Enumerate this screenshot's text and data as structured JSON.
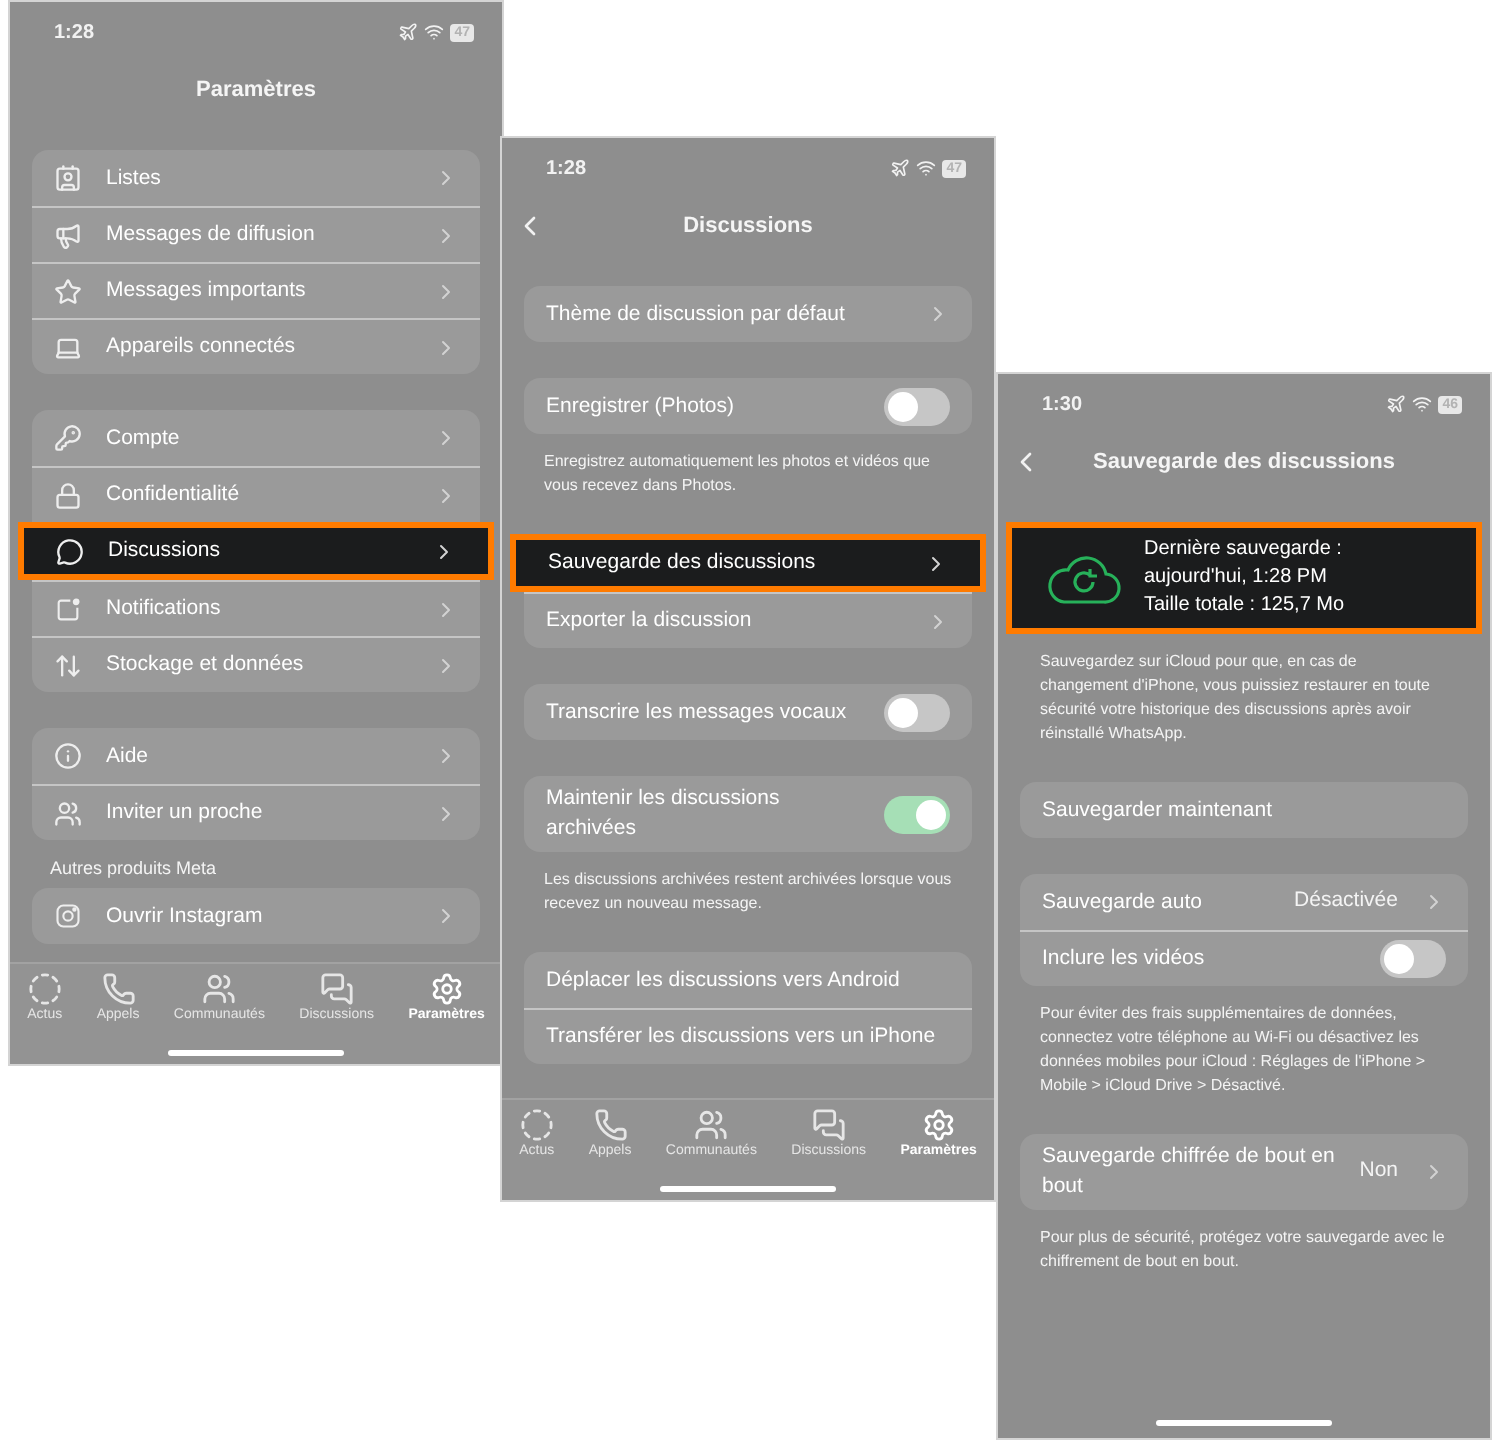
{
  "screens": [
    {
      "time": "1:28",
      "battery": "47",
      "title": "Paramètres",
      "back": false,
      "sections": [
        {
          "items": [
            {
              "kind": "menu",
              "label": "Listes",
              "highlighted": false
            },
            {
              "kind": "menu",
              "label": "Messages de diffusion",
              "highlighted": false
            },
            {
              "kind": "menu",
              "label": "Messages importants",
              "highlighted": false
            },
            {
              "kind": "menu",
              "label": "Appareils connectés",
              "highlighted": false
            }
          ]
        },
        {
          "items": [
            {
              "kind": "menu",
              "label": "Compte",
              "highlighted": false
            },
            {
              "kind": "menu",
              "label": "Confidentialité",
              "highlighted": false
            },
            {
              "kind": "menu",
              "label": "Discussions",
              "highlighted": true
            },
            {
              "kind": "menu",
              "label": "Notifications",
              "highlighted": false
            },
            {
              "kind": "menu",
              "label": "Stockage et données",
              "highlighted": false
            }
          ]
        },
        {
          "items": [
            {
              "kind": "menu",
              "label": "Aide",
              "highlighted": false
            },
            {
              "kind": "menu",
              "label": "Inviter un proche",
              "highlighted": false
            }
          ]
        },
        {
          "header": "Autres produits Meta",
          "items": [
            {
              "kind": "menu",
              "label": "Ouvrir Instagram",
              "highlighted": false
            }
          ]
        }
      ],
      "tabs": [
        {
          "label": "Actus",
          "selected": false
        },
        {
          "label": "Appels",
          "selected": false
        },
        {
          "label": "Communautés",
          "selected": false
        },
        {
          "label": "Discussions",
          "selected": false
        },
        {
          "label": "Paramètres",
          "selected": true
        }
      ]
    },
    {
      "time": "1:28",
      "battery": "47",
      "title": "Discussions",
      "back": true,
      "sections": [
        {
          "items": [
            {
              "kind": "link",
              "label": "Thème de discussion par défaut",
              "highlighted": false
            }
          ]
        },
        {
          "items": [
            {
              "kind": "toggle",
              "label": "Enregistrer (Photos)",
              "on": false,
              "highlighted": false
            }
          ],
          "footer": "Enregistrez automatiquement les photos et vidéos que vous recevez dans Photos."
        },
        {
          "items": [
            {
              "kind": "link",
              "label": "Sauvegarde des discussions",
              "highlighted": true
            },
            {
              "kind": "link",
              "label": "Exporter la discussion",
              "highlighted": false
            }
          ]
        },
        {
          "items": [
            {
              "kind": "toggle",
              "label": "Transcrire les messages vocaux",
              "on": false,
              "highlighted": false
            }
          ]
        },
        {
          "items": [
            {
              "kind": "toggle",
              "label": "Maintenir les discussions archivées",
              "on": true,
              "highlighted": false
            }
          ],
          "footer": "Les discussions archivées restent archivées lorsque vous recevez un nouveau message."
        },
        {
          "items": [
            {
              "kind": "action",
              "label": "Déplacer les discussions vers Android",
              "highlighted": false
            },
            {
              "kind": "action",
              "label": "Transférer les discussions vers un iPhone",
              "highlighted": false
            }
          ]
        }
      ],
      "tabs": [
        {
          "label": "Actus",
          "selected": false
        },
        {
          "label": "Appels",
          "selected": false
        },
        {
          "label": "Communautés",
          "selected": false
        },
        {
          "label": "Discussions",
          "selected": false
        },
        {
          "label": "Paramètres",
          "selected": true
        }
      ]
    },
    {
      "time": "1:30",
      "battery": "46",
      "title": "Sauvegarde des discussions",
      "back": true,
      "sections": [
        {
          "items": [
            {
              "kind": "backup",
              "label": "Dernière sauvegarde : aujourd'hui, 1:28 PM",
              "detail": "Taille totale : 125,7 Mo",
              "highlighted": true
            }
          ],
          "footer": "Sauvegardez sur iCloud pour que, en cas de changement d'iPhone, vous puissiez restaurer en toute sécurité votre historique des discussions après avoir réinstallé WhatsApp."
        },
        {
          "items": [
            {
              "kind": "action",
              "label": "Sauvegarder maintenant",
              "highlighted": false
            }
          ]
        },
        {
          "items": [
            {
              "kind": "link",
              "label": "Sauvegarde auto",
              "value": "Désactivée",
              "highlighted": false
            },
            {
              "kind": "toggle",
              "label": "Inclure les vidéos",
              "on": false,
              "highlighted": false
            }
          ],
          "footer": "Pour éviter des frais supplémentaires de données, connectez votre téléphone au Wi-Fi ou désactivez les données mobiles pour iCloud : Réglages de l'iPhone > Mobile > iCloud Drive > Désactivé."
        },
        {
          "items": [
            {
              "kind": "link",
              "label": "Sauvegarde chiffrée de bout en bout",
              "value": "Non",
              "highlighted": false
            }
          ],
          "footer": "Pour plus de sécurité, protégez votre sauvegarde avec le chiffrement de bout en bout."
        }
      ]
    }
  ]
}
